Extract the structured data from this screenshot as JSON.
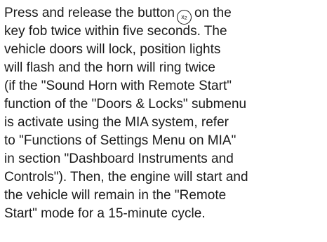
{
  "paragraph": {
    "line1_before_icon": "Press and release the button",
    "icon_main": "x",
    "icon_sub": "2",
    "line1_after_icon": "on the",
    "lines": [
      "key fob twice within five seconds. The",
      "vehicle doors will lock, position lights",
      "will flash and the horn will ring twice",
      "(if the \"Sound Horn with Remote Start\"",
      "function of the \"Doors & Locks\" submenu",
      "is activate using the MIA system, refer",
      "to \"Functions of Settings Menu on MIA\"",
      "in section \"Dashboard Instruments and",
      "Controls\"). Then, the engine will start and",
      "the vehicle will remain in the \"Remote",
      "Start\" mode for a 15-minute cycle."
    ]
  },
  "icons": {
    "button_icon": "remote-start-x2-button-icon"
  }
}
